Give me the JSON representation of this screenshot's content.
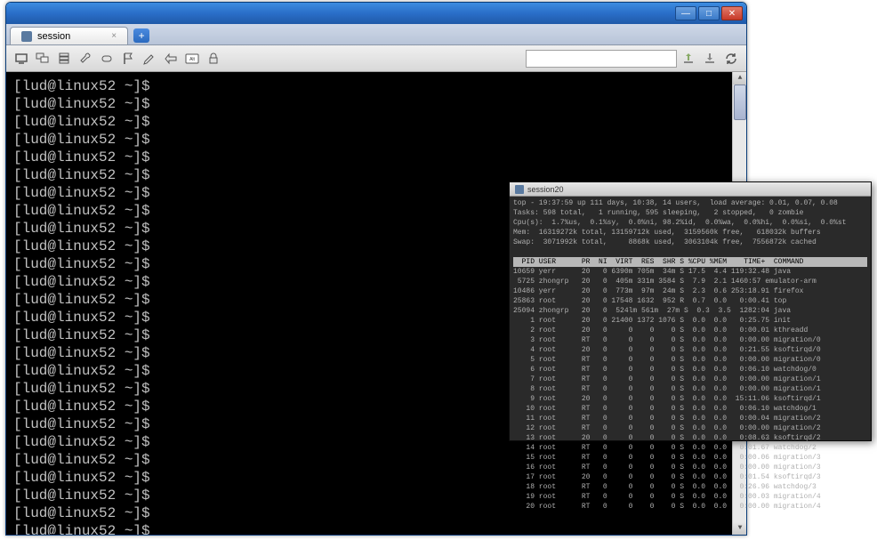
{
  "window": {
    "tab_title": "session",
    "search_placeholder": ""
  },
  "terminal": {
    "prompt": "[lud@linux52 ~]$",
    "line_count": 26
  },
  "popup": {
    "title": "session20",
    "summary": [
      "top - 19:37:59 up 111 days, 10:38, 14 users,  load average: 0.01, 0.07, 0.08",
      "Tasks: 598 total,   1 running, 595 sleeping,   2 stopped,   0 zombie",
      "Cpu(s):  1.7%us,  0.1%sy,  0.0%ni, 98.2%id,  0.0%wa,  0.0%hi,  0.0%si,  0.0%st",
      "Mem:  16319272k total, 13159712k used,  3159560k free,   618032k buffers",
      "Swap:  3071992k total,     8868k used,  3063104k free,  7556872k cached"
    ],
    "columns": "  PID USER      PR  NI  VIRT  RES  SHR S %CPU %MEM    TIME+  COMMAND",
    "rows": [
      "10659 yerr      20   0 6390m 705m  34m S 17.5  4.4 119:32.48 java",
      " 5725 zhongrp   20   0  405m 331m 3584 S  7.9  2.1 1460:57 emulator-arm",
      "10486 yerr      20   0  773m  97m  24m S  2.3  0.6 253:18.91 firefox",
      "25863 root      20   0 17548 1632  952 R  0.7  0.0   0:00.41 top",
      "25094 zhongrp   20   0  524lm 561m  27m S  0.3  3.5  1282:04 java",
      "    1 root      20   0 21400 1372 1076 S  0.0  0.0   0:25.75 init",
      "    2 root      20   0     0    0    0 S  0.0  0.0   0:00.01 kthreadd",
      "    3 root      RT   0     0    0    0 S  0.0  0.0   0:00.00 migration/0",
      "    4 root      20   0     0    0    0 S  0.0  0.0   0:21.55 ksoftirqd/0",
      "    5 root      RT   0     0    0    0 S  0.0  0.0   0:00.00 migration/0",
      "    6 root      RT   0     0    0    0 S  0.0  0.0   0:06.10 watchdog/0",
      "    7 root      RT   0     0    0    0 S  0.0  0.0   0:00.00 migration/1",
      "    8 root      RT   0     0    0    0 S  0.0  0.0   0:00.00 migration/1",
      "    9 root      20   0     0    0    0 S  0.0  0.0  15:11.06 ksoftirqd/1",
      "   10 root      RT   0     0    0    0 S  0.0  0.0   0:06.10 watchdog/1",
      "   11 root      RT   0     0    0    0 S  0.0  0.0   0:00.04 migration/2",
      "   12 root      RT   0     0    0    0 S  0.0  0.0   0:00.00 migration/2",
      "   13 root      20   0     0    0    0 S  0.0  0.0   0:08.63 ksoftirqd/2",
      "   14 root      RT   0     0    0    0 S  0.0  0.0   0:01.67 watchdog/2",
      "   15 root      RT   0     0    0    0 S  0.0  0.0   0:00.06 migration/3",
      "   16 root      RT   0     0    0    0 S  0.0  0.0   0:00.00 migration/3",
      "   17 root      20   0     0    0    0 S  0.0  0.0   0:01.54 ksoftirqd/3",
      "   18 root      RT   0     0    0    0 S  0.0  0.0   0:26.96 watchdog/3",
      "   19 root      RT   0     0    0    0 S  0.0  0.0   0:00.03 migration/4",
      "   20 root      RT   0     0    0    0 S  0.0  0.0   0:00.00 migration/4"
    ]
  }
}
